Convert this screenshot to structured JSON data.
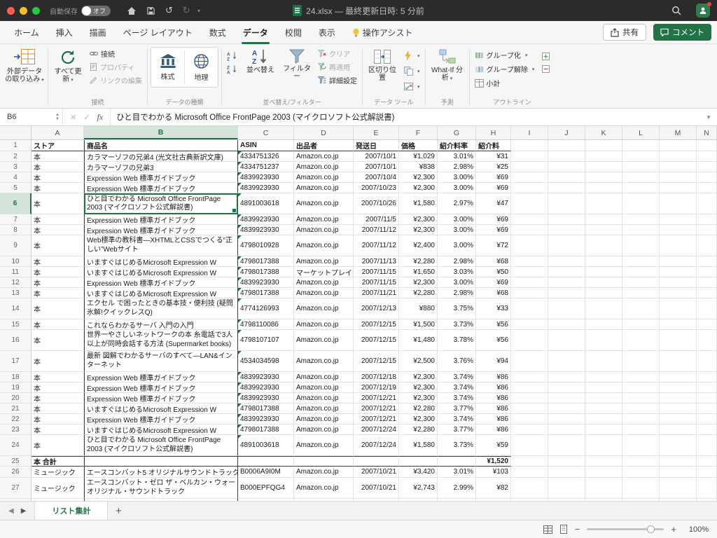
{
  "titlebar": {
    "autosave_label": "自動保存",
    "autosave_state": "オフ",
    "doc_title": "24.xlsx — 最終更新日時: 5 分前"
  },
  "tabs": {
    "items": [
      "ホーム",
      "挿入",
      "描画",
      "ページ レイアウト",
      "数式",
      "データ",
      "校閲",
      "表示",
      "操作アシスト"
    ],
    "active": "データ",
    "share": "共有",
    "comment": "コメント"
  },
  "ribbon": {
    "external_big": "外部データの取り込み",
    "refresh_big": "すべて更新",
    "conn_items": [
      "接続",
      "プロパティ",
      "リンクの編集"
    ],
    "conn_label": "接続",
    "datatype_items": [
      "株式",
      "地理"
    ],
    "datatype_label": "データの種類",
    "sort_big": "並べ替え",
    "filter_big": "フィルター",
    "sort_items": [
      "クリア",
      "再適用",
      "詳細設定"
    ],
    "sort_label": "並べ替え/フィルター",
    "tools_big": "区切り位置",
    "tools_label": "データ ツール",
    "forecast_big": "What-If 分析",
    "forecast_label": "予測",
    "outline_items": [
      "グループ化",
      "グループ解除",
      "小計"
    ],
    "outline_label": "アウトライン"
  },
  "formula_bar": {
    "name_box": "B6",
    "fx": "fx",
    "cancel": "✕",
    "enter": "✓",
    "value": "ひと目でわかる Microsoft Office FrontPage 2003 (マイクロソフト公式解説書)"
  },
  "sheet": {
    "columns": [
      "A",
      "B",
      "C",
      "D",
      "E",
      "F",
      "G",
      "H",
      "I",
      "J",
      "K",
      "L",
      "M",
      "N"
    ],
    "selection": {
      "col": "B",
      "row": 6
    },
    "rows": [
      {
        "n": 1,
        "lines": 1,
        "bold": true,
        "c": [
          "ストア",
          "商品名",
          "ASIN",
          "出品者",
          "発送日",
          "価格",
          "紹介料率",
          "紹介料"
        ]
      },
      {
        "n": 2,
        "lines": 1,
        "tri": true,
        "c": [
          "本",
          "カラマーゾフの兄弟4 (光文社古典新訳文庫)",
          "4334751326",
          "Amazon.co.jp",
          "2007/10/1",
          "¥1,029",
          "3.01%",
          "¥31"
        ]
      },
      {
        "n": 3,
        "lines": 1,
        "tri": true,
        "c": [
          "本",
          "カラマーゾフの兄弟3",
          "4334751237",
          "Amazon.co.jp",
          "2007/10/1",
          "¥838",
          "2.98%",
          "¥25"
        ]
      },
      {
        "n": 4,
        "lines": 1,
        "tri": true,
        "c": [
          "本",
          "Expression Web 標準ガイドブック",
          "4839923930",
          "Amazon.co.jp",
          "2007/10/4",
          "¥2,300",
          "3.00%",
          "¥69"
        ]
      },
      {
        "n": 5,
        "lines": 1,
        "tri": true,
        "c": [
          "本",
          "Expression Web 標準ガイドブック",
          "4839923930",
          "Amazon.co.jp",
          "2007/10/23",
          "¥2,300",
          "3.00%",
          "¥69"
        ]
      },
      {
        "n": 6,
        "lines": 2,
        "tri": true,
        "c": [
          "本",
          "ひと目でわかる Microsoft Office FrontPage 2003 (マイクロソフト公式解説書)",
          "4891003618",
          "Amazon.co.jp",
          "2007/10/26",
          "¥1,580",
          "2.97%",
          "¥47"
        ]
      },
      {
        "n": 7,
        "lines": 1,
        "tri": true,
        "c": [
          "本",
          "Expression Web 標準ガイドブック",
          "4839923930",
          "Amazon.co.jp",
          "2007/11/5",
          "¥2,300",
          "3.00%",
          "¥69"
        ]
      },
      {
        "n": 8,
        "lines": 1,
        "tri": true,
        "c": [
          "本",
          "Expression Web 標準ガイドブック",
          "4839923930",
          "Amazon.co.jp",
          "2007/11/12",
          "¥2,300",
          "3.00%",
          "¥69"
        ]
      },
      {
        "n": 9,
        "lines": 2,
        "tri": true,
        "c": [
          "本",
          "Web標準の教科書―XHTMLとCSSでつくる“正しい”Webサイト",
          "4798010928",
          "Amazon.co.jp",
          "2007/11/12",
          "¥2,400",
          "3.00%",
          "¥72"
        ]
      },
      {
        "n": 10,
        "lines": 1,
        "tri": true,
        "c": [
          "本",
          "いますぐはじめるMicrosoft Expression W",
          "4798017388",
          "Amazon.co.jp",
          "2007/11/13",
          "¥2,280",
          "2.98%",
          "¥68"
        ]
      },
      {
        "n": 11,
        "lines": 1,
        "tri": true,
        "c": [
          "本",
          "いますぐはじめるMicrosoft Expression W",
          "4798017388",
          "マーケットプレイス",
          "2007/11/15",
          "¥1,650",
          "3.03%",
          "¥50"
        ]
      },
      {
        "n": 12,
        "lines": 1,
        "tri": true,
        "c": [
          "本",
          "Expression Web 標準ガイドブック",
          "4839923930",
          "Amazon.co.jp",
          "2007/11/15",
          "¥2,300",
          "3.00%",
          "¥69"
        ]
      },
      {
        "n": 13,
        "lines": 1,
        "tri": true,
        "c": [
          "本",
          "いますぐはじめるMicrosoft Expression W",
          "4798017388",
          "Amazon.co.jp",
          "2007/11/21",
          "¥2,280",
          "2.98%",
          "¥68"
        ]
      },
      {
        "n": 14,
        "lines": 2,
        "tri": true,
        "c": [
          "本",
          "エクセル で困ったときの基本技・便利技 (疑問氷解!クイックレスQ)",
          "4774126993",
          "Amazon.co.jp",
          "2007/12/13",
          "¥880",
          "3.75%",
          "¥33"
        ]
      },
      {
        "n": 15,
        "lines": 1,
        "tri": true,
        "c": [
          "本",
          "これならわかるサーバ 入門の入門",
          "4798110086",
          "Amazon.co.jp",
          "2007/12/15",
          "¥1,500",
          "3.73%",
          "¥56"
        ]
      },
      {
        "n": 16,
        "lines": 2,
        "tri": true,
        "c": [
          "本",
          "世界一やさしいネットワークの本 糸電話で3人以上が同時会話する方法 (Supermarket books)",
          "4798107107",
          "Amazon.co.jp",
          "2007/12/15",
          "¥1,480",
          "3.78%",
          "¥56"
        ]
      },
      {
        "n": 17,
        "lines": 2,
        "tri": true,
        "c": [
          "本",
          "最新 図解でわかるサーバのすべて―LAN&インターネット",
          "4534034598",
          "Amazon.co.jp",
          "2007/12/15",
          "¥2,500",
          "3.76%",
          "¥94"
        ]
      },
      {
        "n": 18,
        "lines": 1,
        "tri": true,
        "c": [
          "本",
          "Expression Web 標準ガイドブック",
          "4839923930",
          "Amazon.co.jp",
          "2007/12/18",
          "¥2,300",
          "3.74%",
          "¥86"
        ]
      },
      {
        "n": 19,
        "lines": 1,
        "tri": true,
        "c": [
          "本",
          "Expression Web 標準ガイドブック",
          "4839923930",
          "Amazon.co.jp",
          "2007/12/19",
          "¥2,300",
          "3.74%",
          "¥86"
        ]
      },
      {
        "n": 20,
        "lines": 1,
        "tri": true,
        "c": [
          "本",
          "Expression Web 標準ガイドブック",
          "4839923930",
          "Amazon.co.jp",
          "2007/12/21",
          "¥2,300",
          "3.74%",
          "¥86"
        ]
      },
      {
        "n": 21,
        "lines": 1,
        "tri": true,
        "c": [
          "本",
          "いますぐはじめるMicrosoft Expression W",
          "4798017388",
          "Amazon.co.jp",
          "2007/12/21",
          "¥2,280",
          "3.77%",
          "¥86"
        ]
      },
      {
        "n": 22,
        "lines": 1,
        "tri": true,
        "c": [
          "本",
          "Expression Web 標準ガイドブック",
          "4839923930",
          "Amazon.co.jp",
          "2007/12/21",
          "¥2,300",
          "3.74%",
          "¥86"
        ]
      },
      {
        "n": 23,
        "lines": 1,
        "tri": true,
        "c": [
          "本",
          "いますぐはじめるMicrosoft Expression W",
          "4798017388",
          "Amazon.co.jp",
          "2007/12/24",
          "¥2,280",
          "3.77%",
          "¥86"
        ]
      },
      {
        "n": 24,
        "lines": 2,
        "tri": true,
        "c": [
          "本",
          "ひと目でわかる Microsoft Office FrontPage 2003 (マイクロソフト公式解説書)",
          "4891003618",
          "Amazon.co.jp",
          "2007/12/24",
          "¥1,580",
          "3.73%",
          "¥59"
        ]
      },
      {
        "n": 25,
        "lines": 1,
        "bold": true,
        "total": true,
        "c": [
          "本 合計",
          "",
          "",
          "",
          "",
          "",
          "",
          "¥1,520"
        ]
      },
      {
        "n": 26,
        "lines": 1,
        "c": [
          "ミュージック",
          "エースコンバット5 オリジナルサウンドトラック",
          "B0006A9I0M",
          "Amazon.co.jp",
          "2007/10/21",
          "¥3,420",
          "3.01%",
          "¥103"
        ]
      },
      {
        "n": 27,
        "lines": 2,
        "c": [
          "ミュージック",
          "エースコンバット・ゼロ ザ・ベルカン・ウォー オリジナル・サウンドトラック",
          "B000EPFQG4",
          "Amazon.co.jp",
          "2007/10/21",
          "¥2,743",
          "2.99%",
          "¥82"
        ]
      },
      {
        "n": 28,
        "lines": 1,
        "c": [
          "",
          "",
          "",
          "",
          "",
          "",
          "",
          ""
        ]
      }
    ]
  },
  "footer": {
    "sheet_tab": "リスト集計",
    "add_tab": "+",
    "zoom": "100%"
  }
}
